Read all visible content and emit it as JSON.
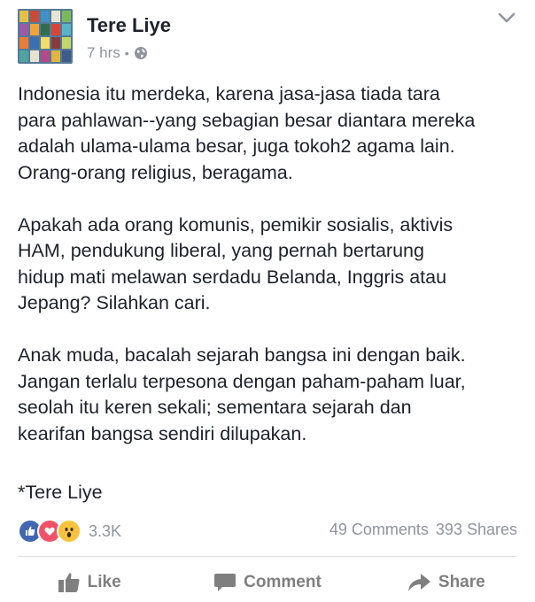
{
  "post": {
    "author": "Tere Liye",
    "time": "7 hrs",
    "separator": "•",
    "paragraphs": [
      "Indonesia itu merdeka, karena jasa-jasa tiada tara\npara pahlawan--yang sebagian besar diantara mereka\nadalah ulama-ulama besar, juga tokoh2 agama lain.\nOrang-orang religius, beragama.",
      "Apakah ada orang komunis, pemikir sosialis, aktivis\nHAM, pendukung liberal, yang pernah bertarung\nhidup mati melawan serdadu Belanda, Inggris atau\nJepang? Silahkan cari.",
      "Anak muda, bacalah sejarah bangsa ini dengan baik.\nJangan terlalu terpesona dengan paham-paham luar,\nseolah itu keren sekali; sementara sejarah dan\nkearifan bangsa sendiri dilupakan."
    ],
    "signature": "*Tere Liye"
  },
  "stats": {
    "reactions": [
      "like-icon",
      "love-icon",
      "wow-icon"
    ],
    "reaction_count": "3.3K",
    "comments": "49 Comments",
    "shares": "393 Shares"
  },
  "actions": {
    "like": "Like",
    "comment": "Comment",
    "share": "Share"
  },
  "colors": {
    "like_blue": "#4267b2",
    "love_red": "#f25268",
    "wow_yellow": "#f7c23e",
    "meta_gray": "#90949c",
    "action_gray": "#7f7f7f"
  }
}
